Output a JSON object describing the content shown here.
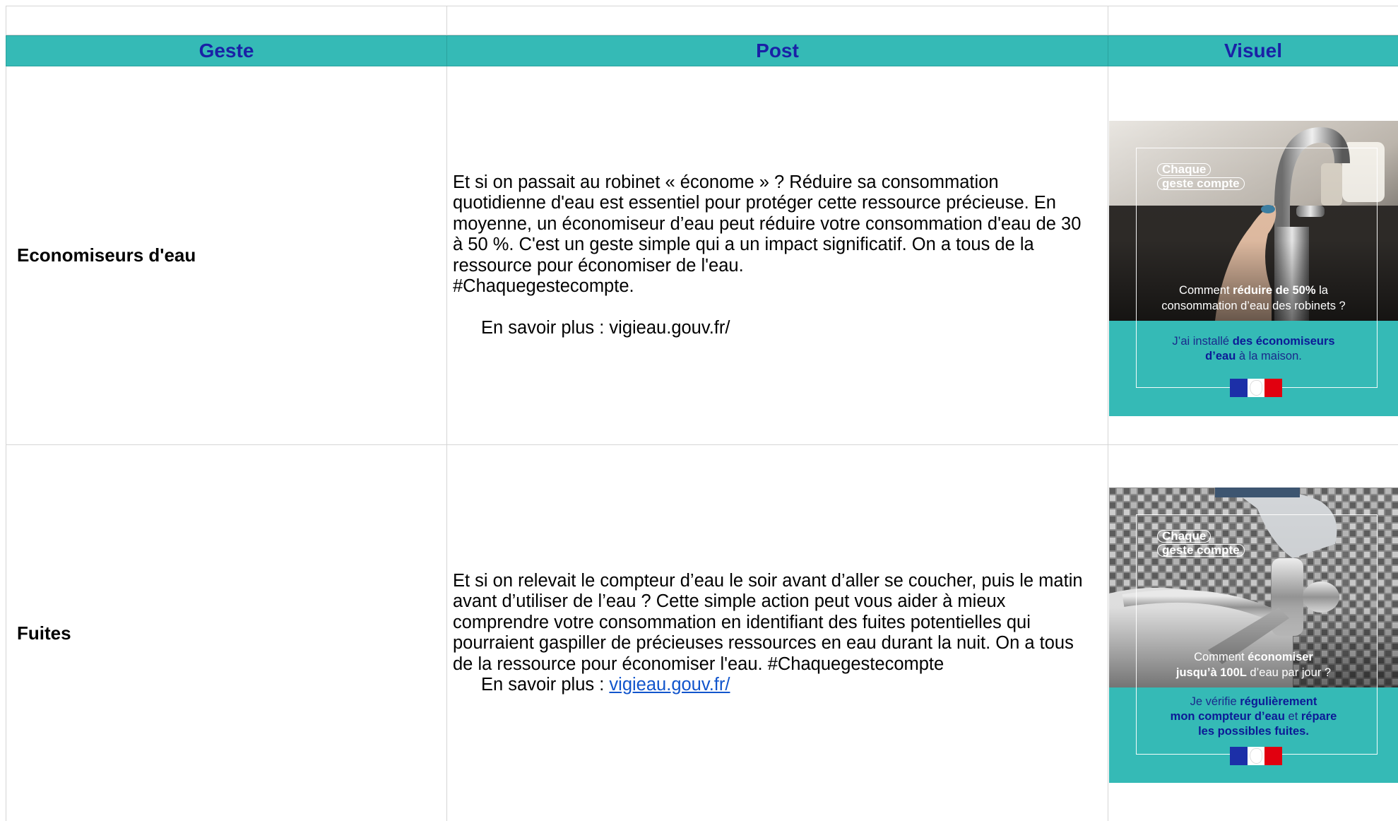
{
  "columns": {
    "geste": "Geste",
    "post": "Post",
    "visuel": "Visuel"
  },
  "rows": [
    {
      "geste": "Economiseurs d'eau",
      "post_text": "Et si on passait au robinet « économe » ? Réduire sa consommation quotidienne d'eau est essentiel pour protéger cette ressource précieuse. En moyenne, un économiseur d’eau peut réduire votre consommation d'eau de 30 à 50 %. C'est un geste simple qui a un impact significatif.  On a tous de la ressource pour économiser de l'eau.",
      "post_hashtag": "#Chaquegestecompte.",
      "more_label": "En savoir plus : ",
      "more_link": "vigieau.gouv.fr/",
      "visual": {
        "logo_line1": "Chaque",
        "logo_line2": "geste compte",
        "caption_pre": "Comment ",
        "caption_bold": "réduire de 50%",
        "caption_post": " la",
        "caption_line2": "consommation d’eau des robinets ?",
        "answer_pre": "J’ai installé ",
        "answer_bold": "des économiseurs",
        "answer_bold2": "d’eau",
        "answer_post": " à la maison.",
        "photo_icon": "faucet-photo"
      }
    },
    {
      "geste": "Fuites",
      "post_text": "Et si on relevait le compteur d’eau le soir avant d’aller se coucher, puis le matin avant d’utiliser de l’eau ? Cette simple action peut vous aider à mieux comprendre votre consommation en identifiant des fuites potentielles qui pourraient gaspiller de précieuses ressources en eau durant la nuit. On a tous de la ressource pour économiser l'eau. #Chaquegestecompte",
      "more_label": "En savoir plus : ",
      "more_link": "vigieau.gouv.fr/",
      "visual": {
        "logo_line1": "Chaque",
        "logo_line2": "geste compte",
        "caption_pre": "Comment ",
        "caption_bold": "économiser",
        "caption_line2_bold": "jusqu’à 100L",
        "caption_line2_post": " d’eau par jour ?",
        "answer_pre": "Je vérifie ",
        "answer_bold": "régulièrement",
        "answer_bold2": "mon compteur d’eau",
        "answer_mid": " et ",
        "answer_bold3": "répare",
        "answer_bold4": "les possibles fuites.",
        "photo_icon": "tap-repair-photo"
      }
    }
  ],
  "colors": {
    "header_bg": "#35bab6",
    "header_text": "#1a21a6",
    "link": "#1155cc",
    "teal": "#35bab6"
  }
}
